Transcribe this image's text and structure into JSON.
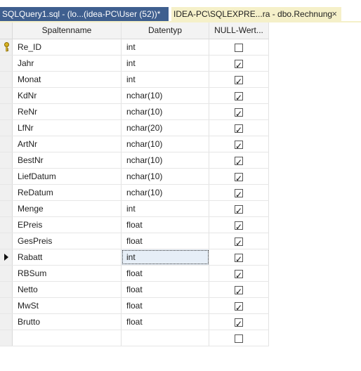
{
  "tabs": [
    {
      "label": "SQLQuery1.sql - (lo...(idea-PC\\User (52))*",
      "active": false
    },
    {
      "label": "IDEA-PC\\SQLEXPRE...ra - dbo.Rechnung",
      "active": true,
      "close": "×"
    }
  ],
  "grid": {
    "headers": {
      "name": "Spaltenname",
      "type": "Datentyp",
      "null": "NULL-Wert..."
    },
    "rows": [
      {
        "name": "Re_ID",
        "type": "int",
        "nullable": false,
        "primary_key": true
      },
      {
        "name": "Jahr",
        "type": "int",
        "nullable": true
      },
      {
        "name": "Monat",
        "type": "int",
        "nullable": true
      },
      {
        "name": "KdNr",
        "type": "nchar(10)",
        "nullable": true
      },
      {
        "name": "ReNr",
        "type": "nchar(10)",
        "nullable": true
      },
      {
        "name": "LfNr",
        "type": "nchar(20)",
        "nullable": true
      },
      {
        "name": "ArtNr",
        "type": "nchar(10)",
        "nullable": true
      },
      {
        "name": "BestNr",
        "type": "nchar(10)",
        "nullable": true
      },
      {
        "name": "LiefDatum",
        "type": "nchar(10)",
        "nullable": true
      },
      {
        "name": "ReDatum",
        "type": "nchar(10)",
        "nullable": true
      },
      {
        "name": "Menge",
        "type": "int",
        "nullable": true
      },
      {
        "name": "EPreis",
        "type": "float",
        "nullable": true
      },
      {
        "name": "GesPreis",
        "type": "float",
        "nullable": true
      },
      {
        "name": "Rabatt",
        "type": "int",
        "nullable": true,
        "current": true
      },
      {
        "name": "RBSum",
        "type": "float",
        "nullable": true
      },
      {
        "name": "Netto",
        "type": "float",
        "nullable": true
      },
      {
        "name": "MwSt",
        "type": "float",
        "nullable": true
      },
      {
        "name": "Brutto",
        "type": "float",
        "nullable": true
      },
      {
        "name": "",
        "type": "",
        "nullable": false
      }
    ]
  },
  "colors": {
    "active_tab": "#f5f0c9",
    "inactive_tab": "#3f5f8f"
  }
}
